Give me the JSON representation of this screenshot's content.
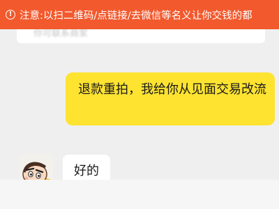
{
  "warning": {
    "icon": "warning-circle-icon",
    "text": "注意:以扫二维码/点链接/去微信等名义让你交钱的都"
  },
  "previous_message": {
    "text": "你可联系商家"
  },
  "messages": [
    {
      "direction": "outgoing",
      "text": "退款重拍，我给你从见面交易改流"
    },
    {
      "direction": "incoming",
      "avatar": "crayon-shin-chan-avatar",
      "text": "好的"
    }
  ],
  "colors": {
    "banner": "#f2592d",
    "outgoing_bubble": "#fee330",
    "incoming_bubble": "#ffffff",
    "background": "#efefef"
  }
}
